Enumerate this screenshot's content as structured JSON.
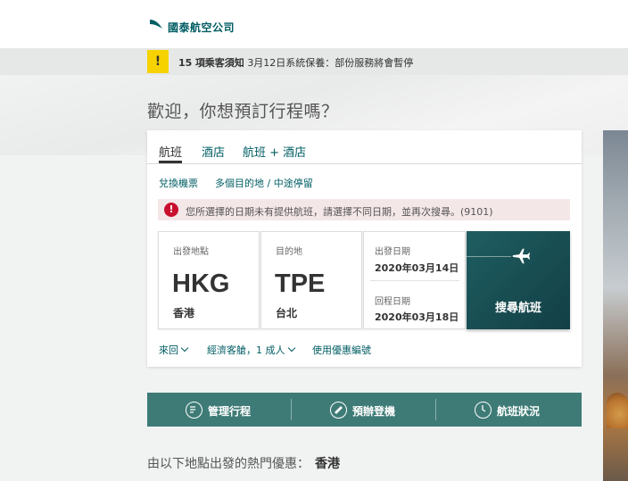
{
  "header": {
    "logo_text": "國泰航空公司"
  },
  "notice": {
    "count": "15",
    "label": "項乘客須知",
    "message": "3月12日系統保養：部份服務將會暫停"
  },
  "welcome": "歡迎，你想預訂行程嗎？",
  "tabs": [
    {
      "label": "航班"
    },
    {
      "label": "酒店"
    },
    {
      "label": "航班 + 酒店"
    }
  ],
  "sublinks": [
    {
      "label": "兌換機票"
    },
    {
      "label": "多個目的地 / 中途停留"
    }
  ],
  "error": {
    "message": "您所選擇的日期未有提供航班，請選擇不同日期，並再次搜尋。(9101)"
  },
  "origin": {
    "label": "出發地點",
    "code": "HKG",
    "city": "香港"
  },
  "destination": {
    "label": "目的地",
    "code": "TPE",
    "city": "台北"
  },
  "dates": {
    "depart_label": "出發日期",
    "depart_value": "2020年03月14日",
    "return_label": "回程日期",
    "return_value": "2020年03月18日"
  },
  "search": {
    "label": "搜尋航班"
  },
  "options": {
    "trip_type": "來回",
    "cabin_pax": "經濟客艙，1 成人",
    "promo": "使用優惠編號"
  },
  "actions": [
    {
      "label": "管理行程"
    },
    {
      "label": "預辦登機"
    },
    {
      "label": "航班狀況"
    }
  ],
  "popular": {
    "prefix": "由以下地點出發的熱門優惠：",
    "city": "香港"
  },
  "colors": {
    "brand": "#005d63",
    "action_bar": "#3e7b76",
    "search_button": "#1f5e61",
    "error": "#c8102e",
    "notice": "#f5d200"
  }
}
